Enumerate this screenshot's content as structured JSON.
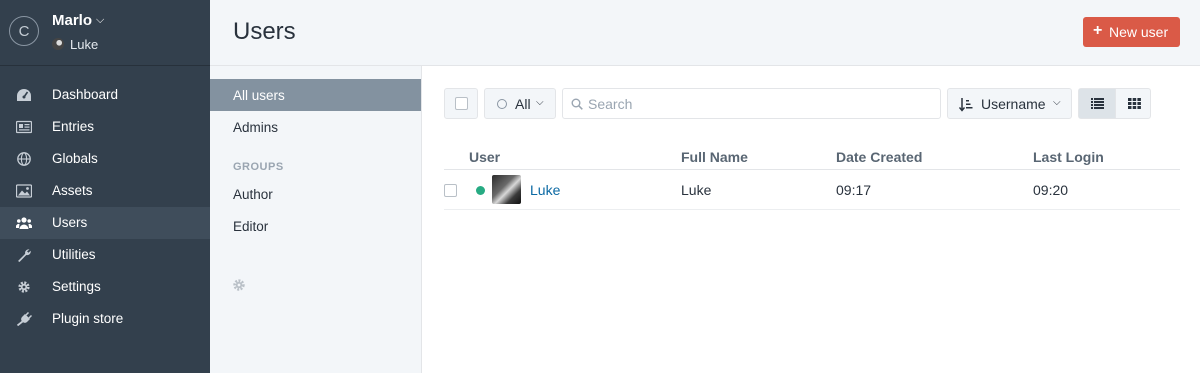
{
  "site": {
    "logo_letter": "C",
    "name": "Marlo",
    "caret": "⌵",
    "current_user": "Luke"
  },
  "nav": [
    {
      "label": "Dashboard",
      "icon": "gauge-icon",
      "active": false
    },
    {
      "label": "Entries",
      "icon": "newspaper-icon",
      "active": false
    },
    {
      "label": "Globals",
      "icon": "globe-icon",
      "active": false
    },
    {
      "label": "Assets",
      "icon": "image-icon",
      "active": false
    },
    {
      "label": "Users",
      "icon": "users-icon",
      "active": true
    },
    {
      "label": "Utilities",
      "icon": "wrench-icon",
      "active": false
    },
    {
      "label": "Settings",
      "icon": "gear-icon",
      "active": false
    },
    {
      "label": "Plugin store",
      "icon": "plug-icon",
      "active": false
    }
  ],
  "header": {
    "title": "Users",
    "new_button": "New user",
    "new_button_icon": "+"
  },
  "sources": {
    "items": [
      {
        "label": "All users",
        "active": true
      },
      {
        "label": "Admins",
        "active": false
      }
    ],
    "groups_heading": "GROUPS",
    "groups": [
      {
        "label": "Author"
      },
      {
        "label": "Editor"
      }
    ]
  },
  "toolbar": {
    "status_label": "All",
    "search_placeholder": "Search",
    "sort_label": "Username",
    "view_mode": "table"
  },
  "table": {
    "columns": [
      "User",
      "Full Name",
      "Date Created",
      "Last Login"
    ],
    "rows": [
      {
        "username": "Luke",
        "full_name": "Luke",
        "date_created": "09:17",
        "last_login": "09:20",
        "status": "active"
      }
    ]
  },
  "colors": {
    "sidebar": "#33404d",
    "accent": "#da5a47",
    "link": "#0b69a3",
    "status_active": "#27ab83"
  }
}
